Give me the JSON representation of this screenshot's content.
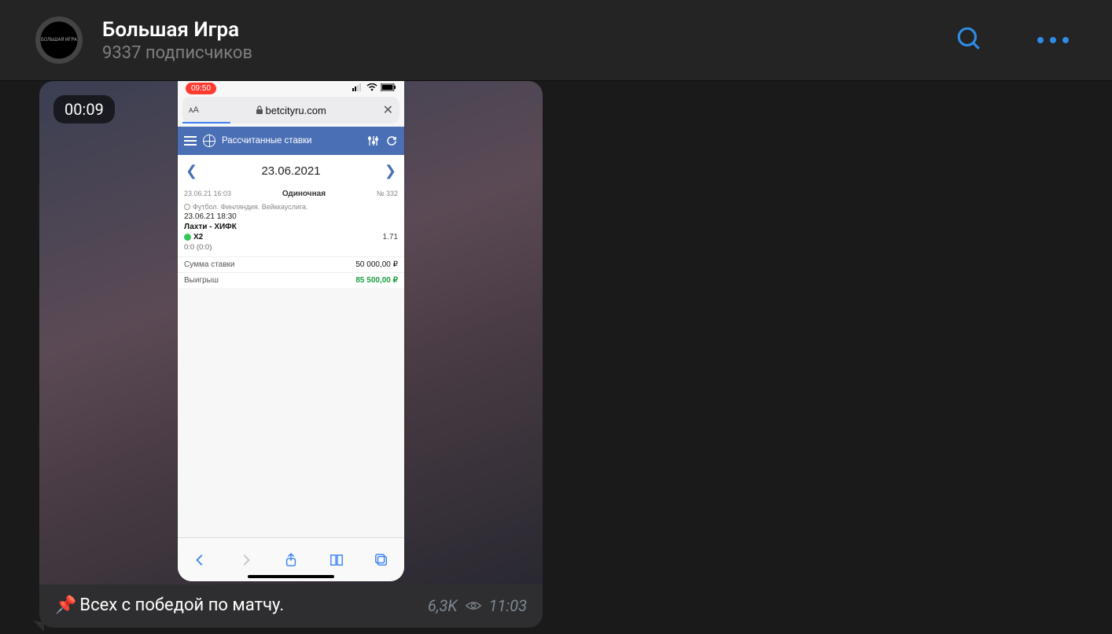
{
  "header": {
    "title": "Большая Игра",
    "subtitle": "9337 подписчиков",
    "avatar_label": "БОЛЬШАЯ\nИГРА"
  },
  "message": {
    "duration": "00:09",
    "caption": "Всех с победой по матчу.",
    "views": "6,3K",
    "time": "11:03"
  },
  "phone": {
    "rec_time": "09:50",
    "url": "betcityru.com",
    "site_title": "Рассчитанные ставки",
    "date": "23.06.2021",
    "bet": {
      "ts_left": "23.06.21 16:03",
      "center": "Одиночная",
      "num": "№ 332",
      "league": "Футбол. Финляндия. Вейккауслига.",
      "dt": "23.06.21 18:30",
      "match": "Лахти - ХИФК",
      "outcome": "X2",
      "coef": "1.71",
      "score": "0:0 (0:0)",
      "sum_lbl": "Сумма ставки",
      "sum_val": "50 000,00 ₽",
      "win_lbl": "Выигрыш",
      "win_val": "85 500,00 ₽"
    }
  }
}
